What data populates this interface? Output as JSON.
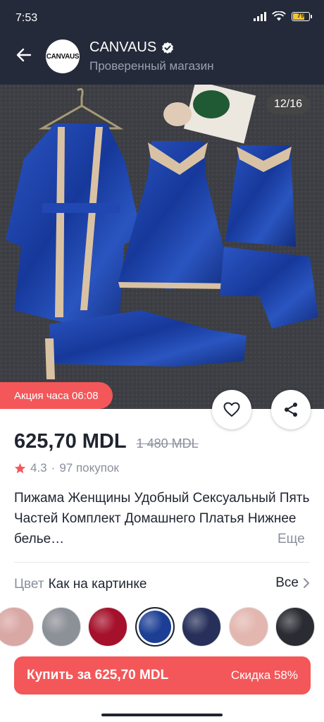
{
  "status_bar": {
    "time": "7:53",
    "battery": "79"
  },
  "store": {
    "logo_text": "CANVAUS",
    "name": "CANVAUS",
    "subtitle": "Проверенный магазин"
  },
  "gallery": {
    "counter": "12/16",
    "promo": "Акция часа 06:08"
  },
  "product": {
    "price": "625,70 MDL",
    "old_price": "1 480 MDL",
    "rating": "4.3",
    "separator": "·",
    "purchases": "97 покупок",
    "title": "Пижама Женщины Удобный Сексуальный Пять Частей Комплект Домашнего Платья Нижнее белье…",
    "more": "Еще"
  },
  "color": {
    "label": "Цвет",
    "value": "Как на картинке",
    "all": "Все",
    "swatches": [
      {
        "name": "pink",
        "color": "#d9a7a4"
      },
      {
        "name": "grey",
        "color": "#8c9097"
      },
      {
        "name": "red",
        "color": "#a5102a"
      },
      {
        "name": "blue",
        "color": "#1c3f95"
      },
      {
        "name": "navy-floral",
        "color": "#26305a"
      },
      {
        "name": "pink-floral",
        "color": "#e3b7b0"
      },
      {
        "name": "black-floral",
        "color": "#2b2c33"
      }
    ],
    "selected_index": 3
  },
  "cta": {
    "buy": "Купить за 625,70 MDL",
    "discount": "Скидка 58%"
  },
  "colors": {
    "header": "#252a3a",
    "accent": "#f45759",
    "text": "#1f2430",
    "muted": "#8a8f9c"
  }
}
